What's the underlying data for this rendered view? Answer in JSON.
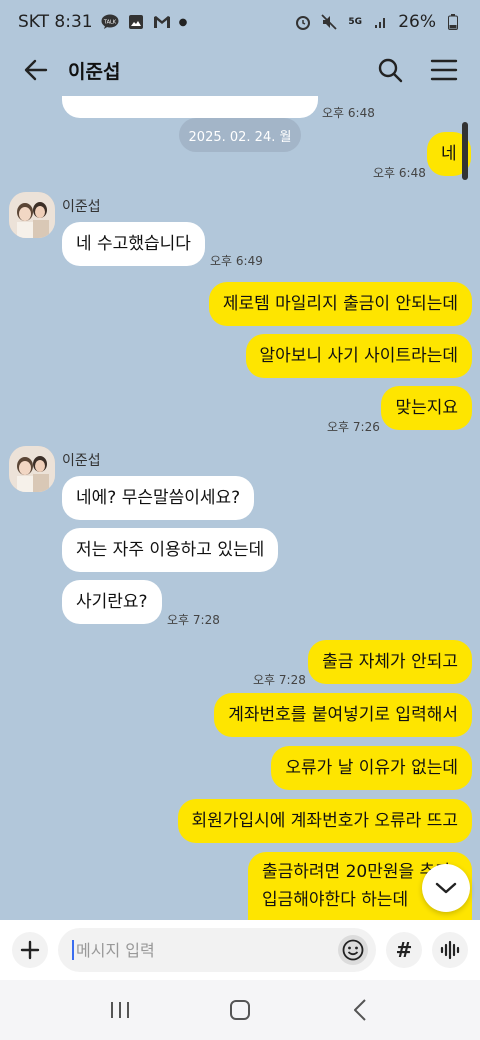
{
  "status_bar": {
    "carrier_time": "SKT 8:31",
    "talk_badge": "TALK",
    "network": "5G",
    "battery": "26%"
  },
  "header": {
    "title": "이준섭"
  },
  "chat": {
    "top_partial_time": "오후 6:48",
    "date_chip": "2025. 02. 24. 월",
    "msg_ne": "네",
    "msg_ne_time": "오후 6:48",
    "group1_sender": "이준섭",
    "group1_msg": "네 수고했습니다",
    "group1_time": "오후 6:49",
    "out1": "제로템 마일리지 출금이 안되는데",
    "out2": "알아보니 사기 사이트라는데",
    "out3": "맞는지요",
    "out3_time": "오후 7:26",
    "group2_sender": "이준섭",
    "in1": "네에? 무슨말씀이세요?",
    "in2": "저는 자주 이용하고 있는데",
    "in3": "사기란요?",
    "in3_time": "오후 7:28",
    "out4": "출금 자체가 안되고",
    "out4_time": "오후 7:28",
    "out5": "계좌번호를 붙여넣기로 입력해서",
    "out6": "오류가 날 이유가 없는데",
    "out7": "회원가입시에 계좌번호가 오류라 뜨고",
    "out8_line1": "출금하려면 20만원을 추가",
    "out8_line2": "입금해야한다 하는데"
  },
  "input_bar": {
    "placeholder": "메시지 입력",
    "hash_label": "#"
  },
  "icons": {
    "back": "arrow-left-icon",
    "search": "search-icon",
    "menu": "hamburger-menu-icon",
    "plus": "plus-icon",
    "emoji": "emoji-icon",
    "voice": "voice-wave-icon",
    "scroll_down": "chevron-down-icon"
  },
  "colors": {
    "chat_background": "#b2c7da",
    "outgoing_bubble": "#fee500",
    "incoming_bubble": "#ffffff"
  }
}
